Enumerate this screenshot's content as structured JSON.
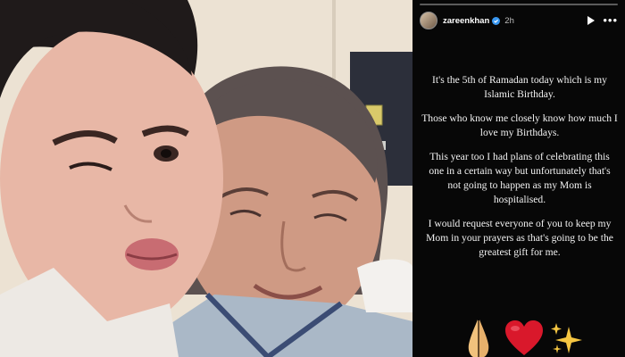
{
  "story": {
    "username": "zareenkhan",
    "time": "2h",
    "paragraphs": [
      "It's the 5th of Ramadan today which is my Islamic Birthday.",
      "Those who know me closely know how much I love my Birthdays.",
      "This year too I had plans of celebrating this one in a certain way but unfortunately that's not going to happen as my Mom is hospitalised.",
      "I would request everyone of you to keep my Mom in your prayers as that's going to be the greatest gift for me."
    ],
    "icons": {
      "verified": "verified-badge-icon",
      "play": "play-icon",
      "more": "more-options-icon",
      "emoji": [
        "praying-hands-icon",
        "red-heart-icon",
        "sparkles-icon"
      ]
    },
    "colors": {
      "background": "#070707",
      "text": "#f2f2f2",
      "heart": "#d9182b"
    }
  }
}
